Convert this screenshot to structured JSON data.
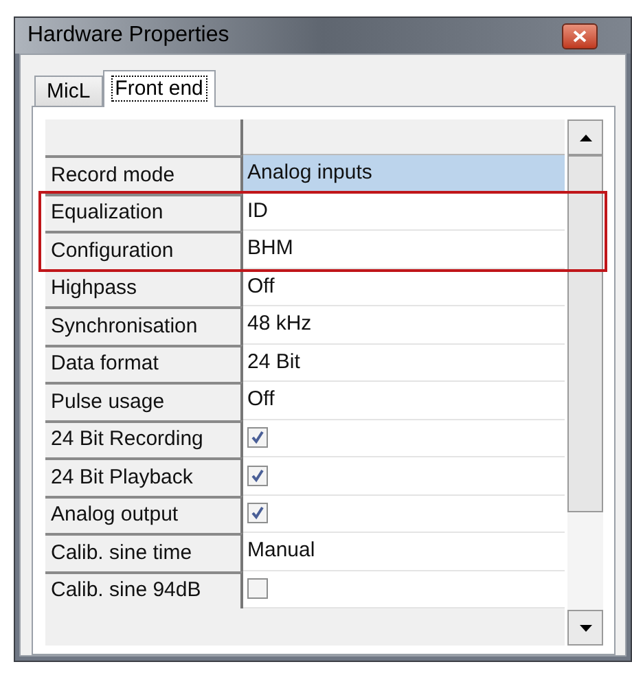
{
  "window": {
    "title": "Hardware Properties"
  },
  "tabs": [
    {
      "label": "MicL",
      "selected": false
    },
    {
      "label": "Front end",
      "selected": true
    }
  ],
  "properties": [
    {
      "label": "Record mode",
      "kind": "text",
      "value": "Analog inputs",
      "selected": true,
      "highlighted": false
    },
    {
      "label": "Equalization",
      "kind": "text",
      "value": "ID",
      "selected": false,
      "highlighted": true
    },
    {
      "label": "Configuration",
      "kind": "text",
      "value": "BHM",
      "selected": false,
      "highlighted": true
    },
    {
      "label": "Highpass",
      "kind": "text",
      "value": "Off",
      "selected": false,
      "highlighted": false
    },
    {
      "label": "Synchronisation",
      "kind": "text",
      "value": "48 kHz",
      "selected": false,
      "highlighted": false
    },
    {
      "label": "Data format",
      "kind": "text",
      "value": "24 Bit",
      "selected": false,
      "highlighted": false
    },
    {
      "label": "Pulse usage",
      "kind": "text",
      "value": "Off",
      "selected": false,
      "highlighted": false
    },
    {
      "label": "24 Bit Recording",
      "kind": "checkbox",
      "checked": true,
      "selected": false,
      "highlighted": false
    },
    {
      "label": "24 Bit Playback",
      "kind": "checkbox",
      "checked": true,
      "selected": false,
      "highlighted": false
    },
    {
      "label": "Analog output",
      "kind": "checkbox",
      "checked": true,
      "selected": false,
      "highlighted": false
    },
    {
      "label": "Calib. sine time",
      "kind": "text",
      "value": "Manual",
      "selected": false,
      "highlighted": false
    },
    {
      "label": "Calib. sine 94dB",
      "kind": "checkbox",
      "checked": false,
      "selected": false,
      "highlighted": false
    }
  ]
}
